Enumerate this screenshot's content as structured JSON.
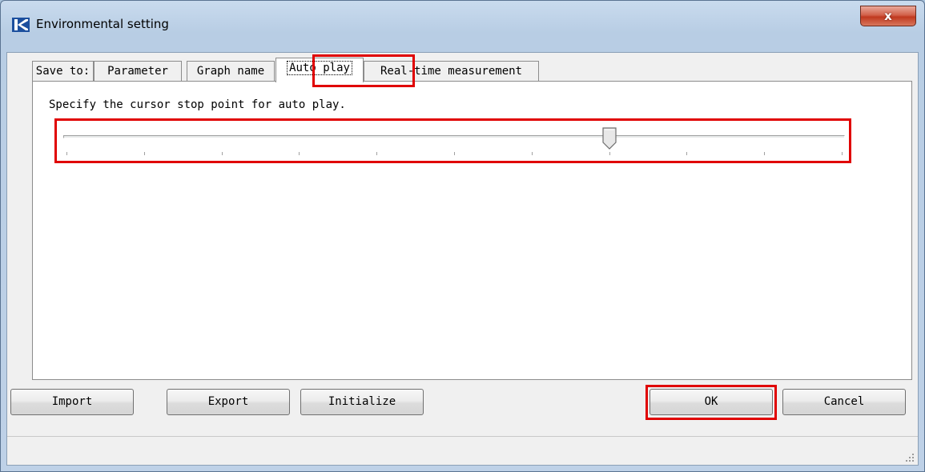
{
  "window": {
    "title": "Environmental setting",
    "close_label": "x"
  },
  "tabs": [
    {
      "label": "Save to:",
      "active": false
    },
    {
      "label": "Parameter",
      "active": false
    },
    {
      "label": "Graph name",
      "active": false
    },
    {
      "label": "Auto play",
      "active": true
    },
    {
      "label": "Real-time measurement",
      "active": false
    }
  ],
  "auto_play": {
    "instruction": "Specify the cursor stop point for auto play.",
    "slider": {
      "min": 0,
      "max": 10,
      "value": 7,
      "tick_count": 11
    }
  },
  "buttons": {
    "import": "Import",
    "export": "Export",
    "initialize": "Initialize",
    "ok": "OK",
    "cancel": "Cancel"
  },
  "highlight_color": "#e00000",
  "icons": [
    "app-logo-icon",
    "close-icon",
    "slider-thumb-icon",
    "resize-grip-icon"
  ]
}
